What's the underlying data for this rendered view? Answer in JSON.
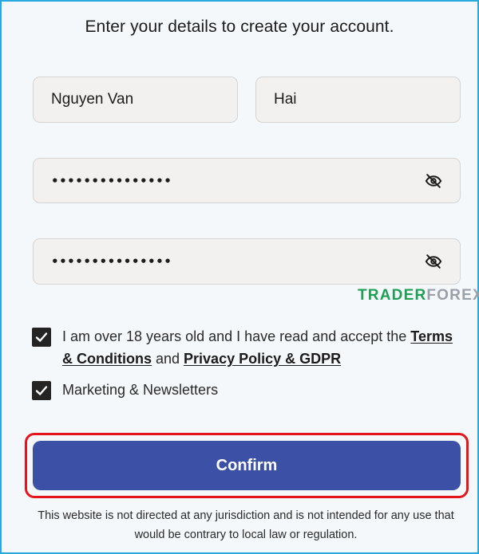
{
  "form": {
    "heading": "Enter your details to create your account.",
    "first_name": {
      "value": "Nguyen Van"
    },
    "last_name": {
      "value": "Hai"
    },
    "password": {
      "value": "•••••••••••••••",
      "icon": "eye-off-icon"
    },
    "confirm_password": {
      "value": "•••••••••••••••",
      "icon": "eye-off-icon"
    },
    "terms": {
      "checked": true,
      "text_before": "I am over 18 years old and I have read and accept the ",
      "terms_link": "Terms & Conditions",
      "and_text": " and ",
      "privacy_link": "Privacy Policy & GDPR"
    },
    "marketing": {
      "checked": true,
      "label": "Marketing & Newsletters"
    },
    "confirm_label": "Confirm",
    "disclaimer": "This website is not directed at any jurisdiction and is not intended for any use that would be contrary to local law or regulation."
  },
  "watermark": {
    "part1": "TRADER",
    "part2": "FOREX"
  },
  "colors": {
    "frame_border": "#29a8e0",
    "confirm_button": "#3c50a6",
    "highlight_outline": "#e4141b",
    "watermark_green": "#1f9e54"
  }
}
